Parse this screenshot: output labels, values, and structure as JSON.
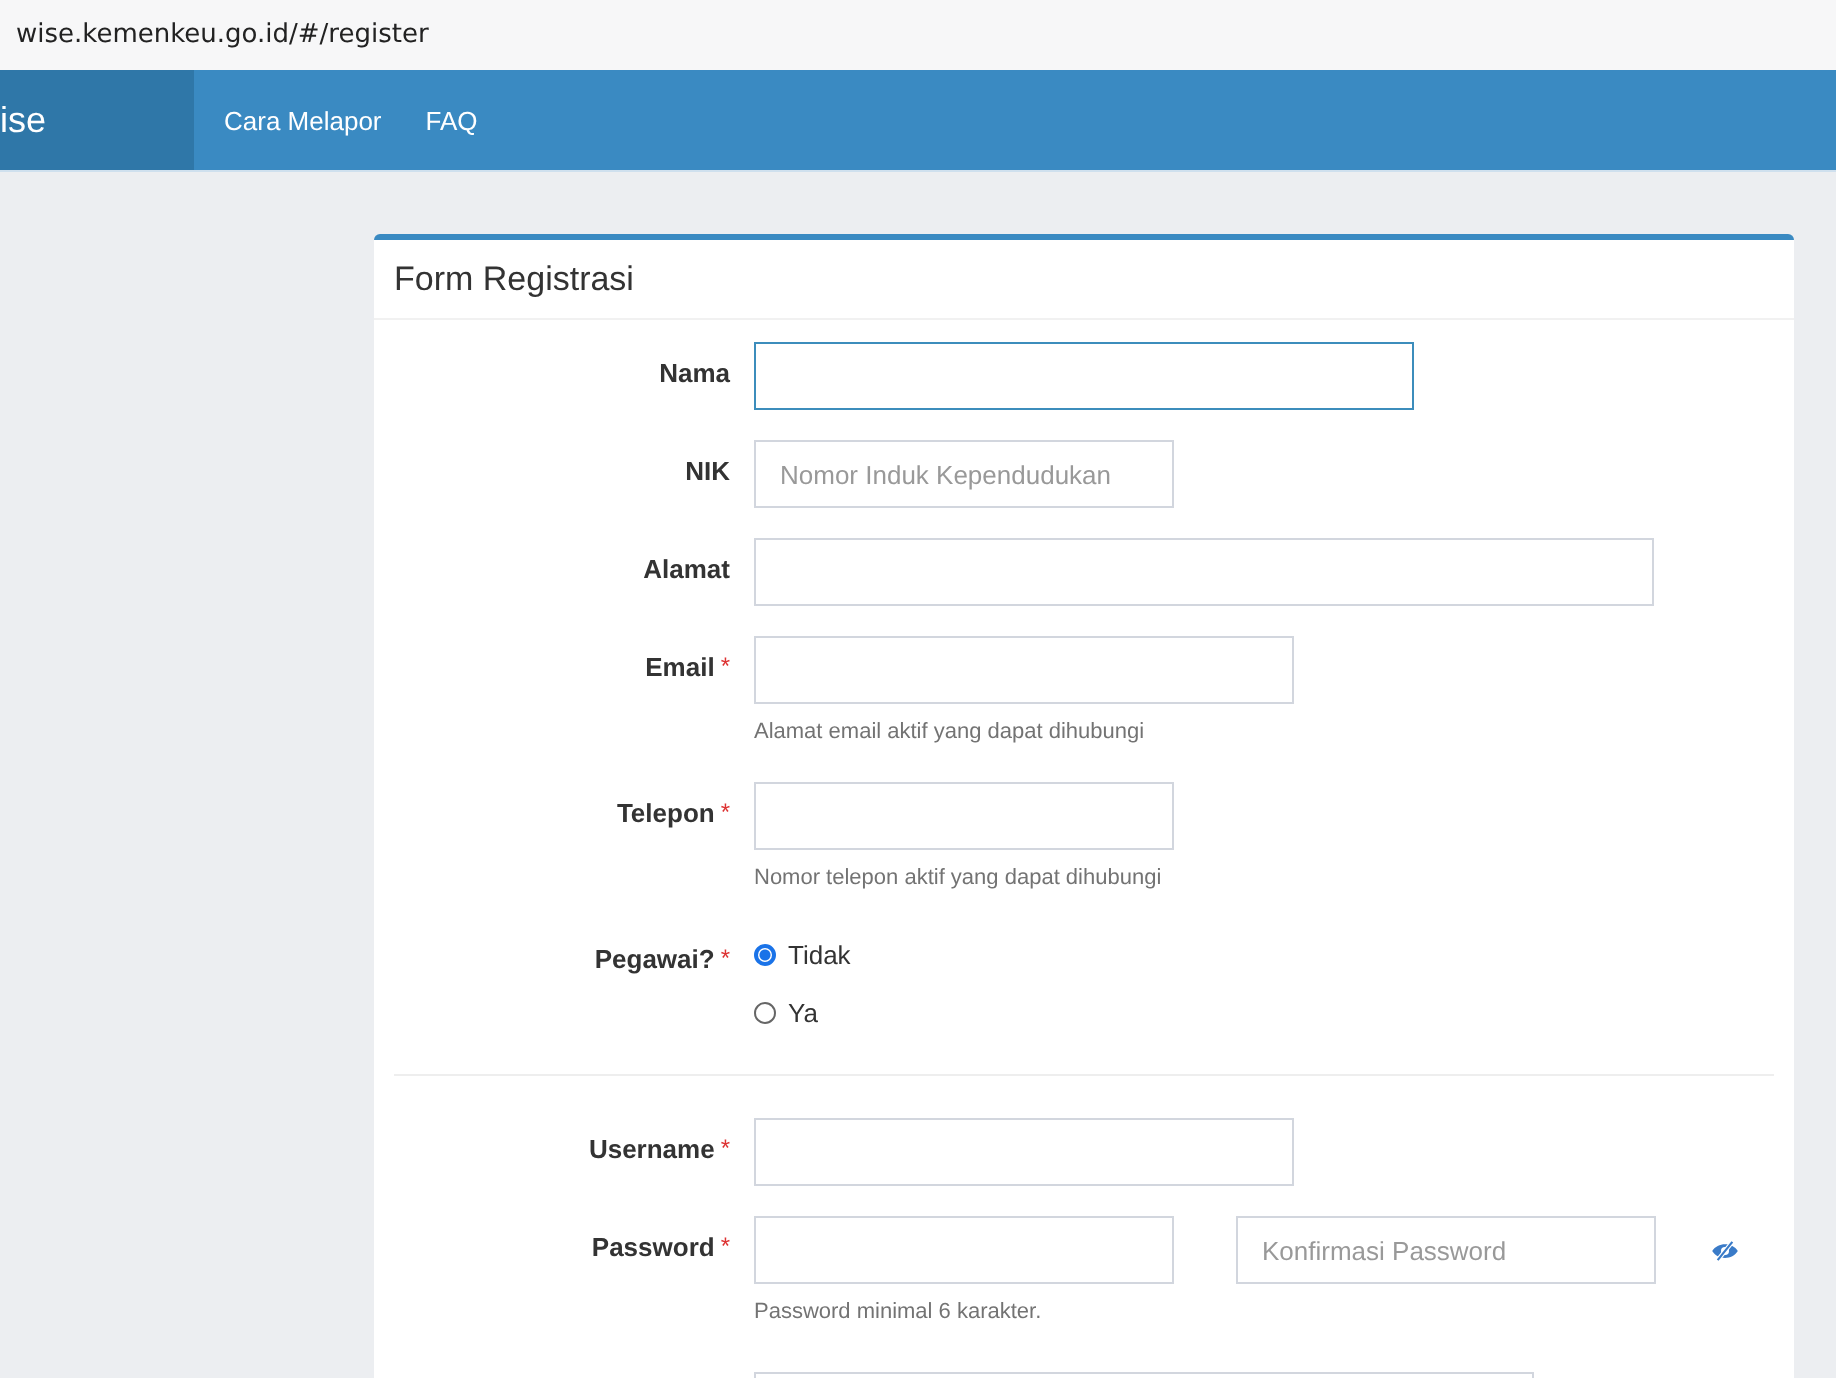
{
  "browser": {
    "url": "wise.kemenkeu.go.id/#/register"
  },
  "navbar": {
    "brand": "ise",
    "links": [
      {
        "label": "Cara Melapor"
      },
      {
        "label": "FAQ"
      }
    ]
  },
  "form": {
    "title": "Form Registrasi",
    "sections": [
      {
        "fields": [
          {
            "kind": "text",
            "label": "Nama",
            "focused": true
          },
          {
            "kind": "text",
            "label": "NIK",
            "placeholder": "Nomor Induk Kependudukan",
            "focused": false
          },
          {
            "kind": "text",
            "label": "Alamat",
            "focused": false
          },
          {
            "kind": "text",
            "label": "Email",
            "required_mark": "*",
            "help": "Alamat email aktif yang dapat dihubungi",
            "focused": false
          },
          {
            "kind": "text",
            "label": "Telepon",
            "required_mark": "*",
            "help": "Nomor telepon aktif yang dapat dihubungi",
            "focused": false
          },
          {
            "kind": "radio",
            "label": "Pegawai?",
            "required_mark": "*",
            "options": [
              {
                "label": "Tidak",
                "selected": true
              },
              {
                "label": "Ya",
                "selected": false
              }
            ]
          }
        ]
      },
      {
        "fields": [
          {
            "kind": "text",
            "label": "Username",
            "required_mark": "*",
            "focused": false
          },
          {
            "kind": "password",
            "label": "Password",
            "required_mark": "*",
            "confirm_placeholder": "Konfirmasi Password",
            "help": "Password minimal 6 karakter.",
            "focused": false
          }
        ]
      }
    ]
  }
}
